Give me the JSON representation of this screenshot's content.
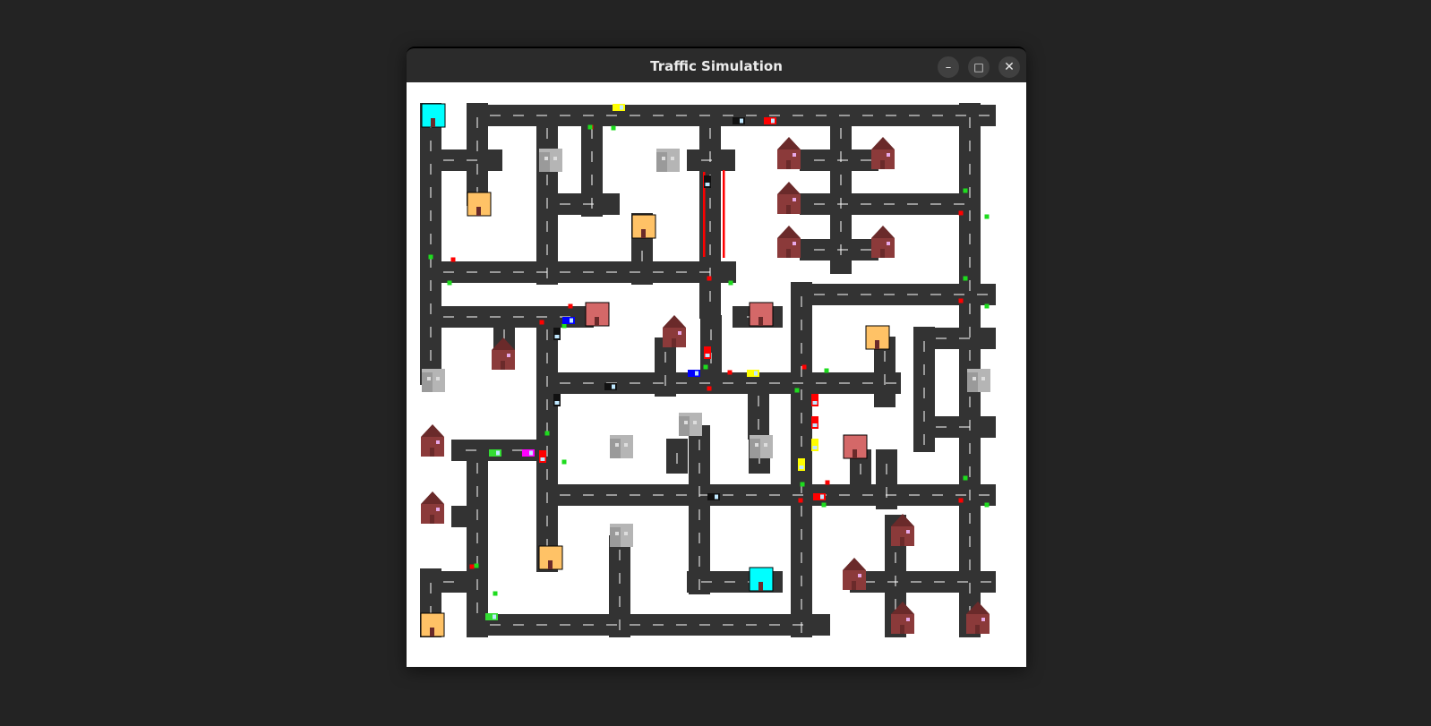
{
  "window": {
    "title": "Traffic Simulation",
    "minimize_glyph": "–",
    "maximize_glyph": "□",
    "close_glyph": "✕"
  },
  "map": {
    "colors": {
      "background": "#ffffff",
      "road": "#333333",
      "lane_marking": "#ffffff",
      "signal_red": "#ff0000",
      "signal_green": "#1edc1e",
      "house_wall": "#8b3a3a",
      "house_roof": "#6a2a2a",
      "house_window": "#e8a8e8",
      "shop": "#ffc266",
      "office": "#d46868",
      "warehouse": "#aaaaaa",
      "depot": "#00ffff",
      "door": "#6a2a2a"
    },
    "building_types": [
      "house",
      "shop",
      "office",
      "warehouse",
      "depot"
    ],
    "vehicle_colors": [
      "#ffff00",
      "#111111",
      "#ff0000",
      "#0000ff",
      "#ff00ff",
      "#33dd33"
    ],
    "vehicle_count": 22,
    "building_count": 38
  }
}
